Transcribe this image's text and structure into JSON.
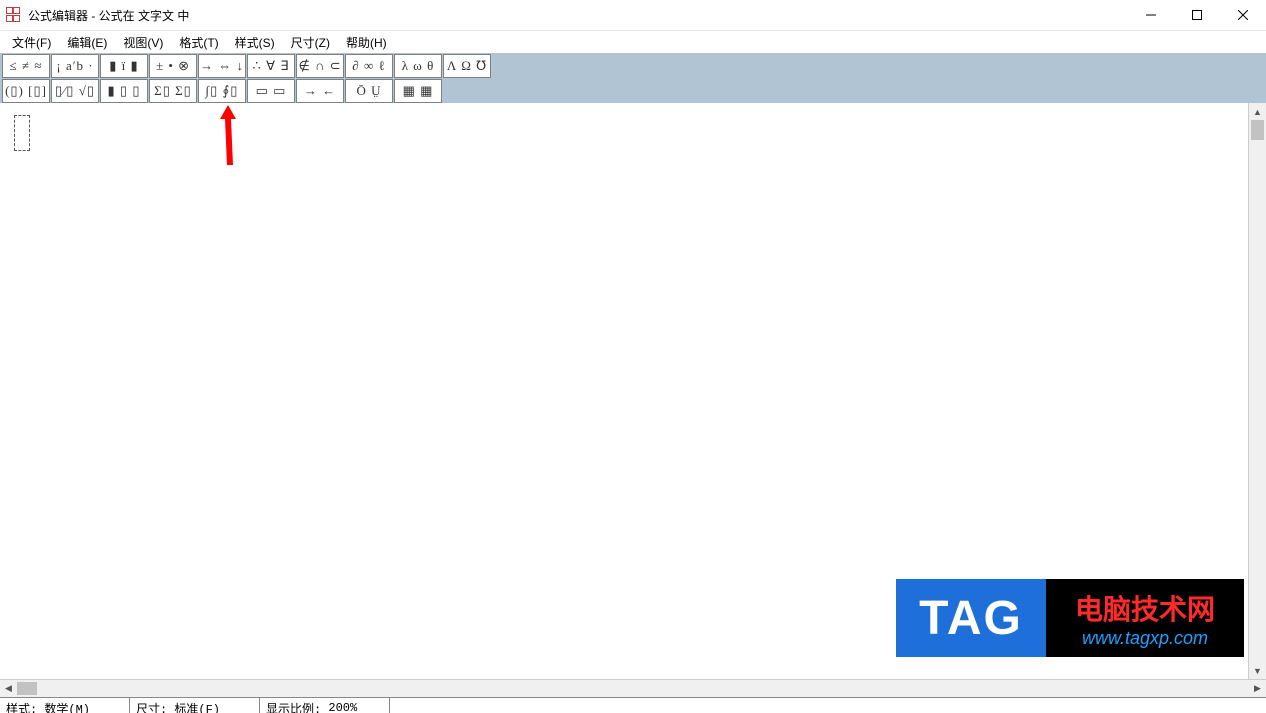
{
  "window": {
    "title": "公式编辑器 - 公式在 文字文 中"
  },
  "menu": {
    "file": "文件(F)",
    "edit": "编辑(E)",
    "view": "视图(V)",
    "format": "格式(T)",
    "style": "样式(S)",
    "size": "尺寸(Z)",
    "help": "帮助(H)"
  },
  "toolbar_row1": {
    "g1": "≤ ≠ ≈",
    "g2": "¡ a′b ·",
    "g3": "▮ ï ▮",
    "g4": "± • ⊗",
    "g5": "→ ⇔ ↓",
    "g6": "∴ ∀ ∃",
    "g7": "∉ ∩ ⊂",
    "g8": "∂ ∞ ℓ",
    "g9": "λ ω θ",
    "g10": "Λ Ω ℧"
  },
  "toolbar_row2": {
    "g1": "(▯) [▯]",
    "g2": "▯⁄▯ √▯",
    "g3": "▮ ▯ ▯",
    "g4": "Σ▯ Σ▯",
    "g5": "∫▯ ∮▯",
    "g6": "▭ ▭",
    "g7": "→ ←",
    "g8": "Ō Ṳ",
    "g9": "▦ ▦"
  },
  "status": {
    "style_label": "样式:",
    "style_value": "数学(M)",
    "size_label": "尺寸:",
    "size_value": "标准(F)",
    "zoom_label": "显示比例:",
    "zoom_value": "200%"
  },
  "watermark": {
    "tag": "TAG",
    "cn": "电脑技术网",
    "url": "www.tagxp.com"
  }
}
